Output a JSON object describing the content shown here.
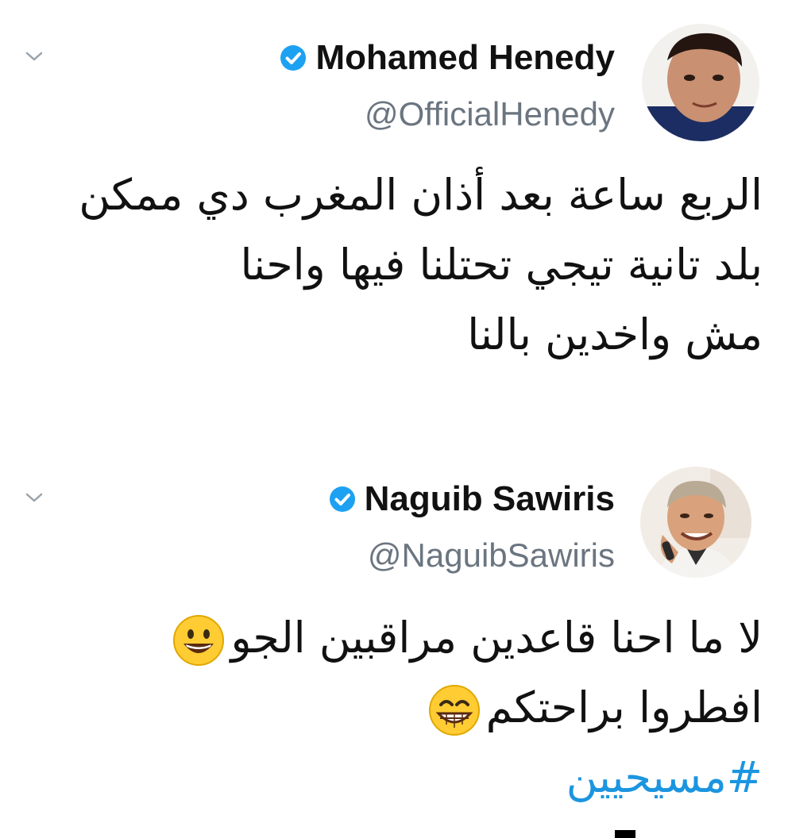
{
  "tweets": [
    {
      "display_name": "Mohamed Henedy",
      "handle": "@OfficialHenedy",
      "verified_icon": "verified-badge-icon",
      "menu_icon": "chevron-down-icon",
      "lines": [
        "الربع ساعة بعد أذان المغرب دي ممكن",
        "بلد تانية تيجي تحتلنا فيها واحنا",
        "مش واخدين بالنا"
      ]
    },
    {
      "display_name": "Naguib Sawiris",
      "handle": "@NaguibSawiris",
      "verified_icon": "verified-badge-icon",
      "menu_icon": "chevron-down-icon",
      "lines": [
        "لا ما احنا قاعدين مراقبين الجو",
        "افطروا براحتكم"
      ],
      "emojis": [
        "grinning-face-emoji",
        "beaming-face-emoji"
      ],
      "hashtag": "#مسيحيين"
    }
  ],
  "colors": {
    "verified": "#1da1f2",
    "handle": "#6b7580",
    "hashtag": "#1b95e0",
    "name": "#111111"
  }
}
